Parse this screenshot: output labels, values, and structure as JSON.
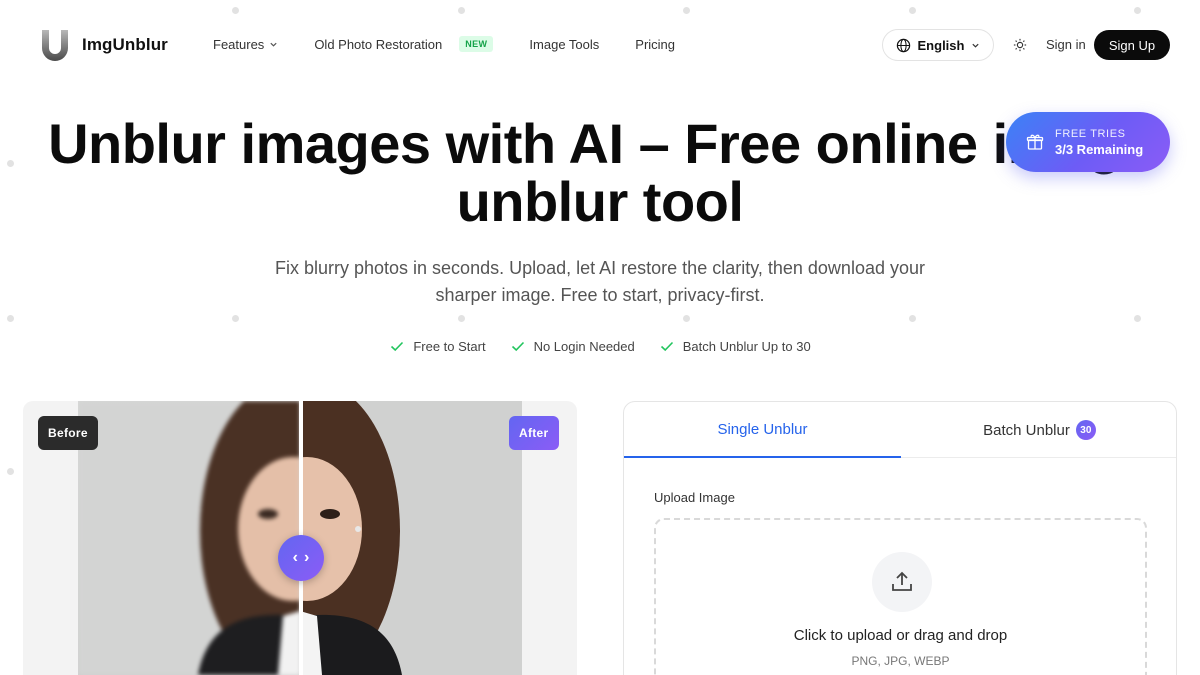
{
  "brand": {
    "name": "ImgUnblur"
  },
  "nav": {
    "features": "Features",
    "old_photo": "Old Photo Restoration",
    "new_badge": "NEW",
    "image_tools": "Image Tools",
    "pricing": "Pricing",
    "language": "English",
    "sign_in": "Sign in",
    "sign_up": "Sign Up"
  },
  "hero": {
    "title_line1": "Unblur images with AI – Free online image",
    "title_line2": "unblur tool",
    "subtitle": "Fix blurry photos in seconds. Upload, let AI restore the clarity, then download your sharper image. Free to start, privacy-first.",
    "checks": [
      "Free to Start",
      "No Login Needed",
      "Batch Unblur Up to 30"
    ]
  },
  "free_tries": {
    "label": "FREE TRIES",
    "value": "3/3 Remaining"
  },
  "compare": {
    "before": "Before",
    "after": "After",
    "split": 0.5
  },
  "upload": {
    "tabs": [
      {
        "label": "Single Unblur",
        "active": true
      },
      {
        "label": "Batch Unblur",
        "badge": "30",
        "active": false
      }
    ],
    "label": "Upload Image",
    "main": "Click to upload or drag and drop",
    "formats": "PNG, JPG, WEBP"
  },
  "colors": {
    "accent": "#2563eb",
    "gradient_start": "#3b82f6",
    "gradient_end": "#8b5cf6",
    "check": "#22c55e",
    "new_badge": "#16a34a"
  }
}
